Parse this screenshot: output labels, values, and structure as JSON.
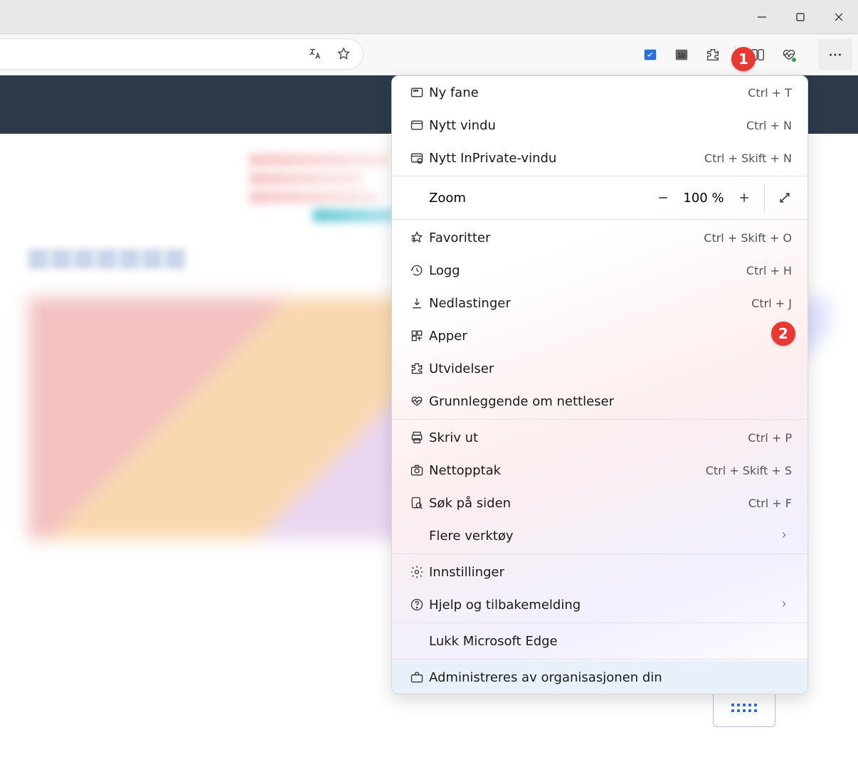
{
  "window": {
    "app": "Microsoft Edge"
  },
  "annotations": {
    "step1": "1",
    "step2": "2"
  },
  "toolbar": {
    "translate_icon": "translate-icon",
    "favorite_icon": "star-icon",
    "ext1_icon": "app-todo-icon",
    "ext2_icon": "app-1b-icon",
    "extensions_icon": "extensions-icon",
    "split_icon": "split-screen-icon",
    "health_icon": "browser-health-icon",
    "more_icon": "more-icon"
  },
  "menu": {
    "new_tab": {
      "label": "Ny fane",
      "shortcut": "Ctrl + T"
    },
    "new_window": {
      "label": "Nytt vindu",
      "shortcut": "Ctrl + N"
    },
    "new_inprivate": {
      "label": "Nytt InPrivate-vindu",
      "shortcut": "Ctrl + Skift + N"
    },
    "zoom": {
      "label": "Zoom",
      "value": "100 %"
    },
    "favorites": {
      "label": "Favoritter",
      "shortcut": "Ctrl + Skift + O"
    },
    "history": {
      "label": "Logg",
      "shortcut": "Ctrl + H"
    },
    "downloads": {
      "label": "Nedlastinger",
      "shortcut": "Ctrl + J"
    },
    "apps": {
      "label": "Apper"
    },
    "extensions": {
      "label": "Utvidelser"
    },
    "essentials": {
      "label": "Grunnleggende om nettleser"
    },
    "print": {
      "label": "Skriv ut",
      "shortcut": "Ctrl + P"
    },
    "capture": {
      "label": "Nettopptak",
      "shortcut": "Ctrl + Skift + S"
    },
    "find": {
      "label": "Søk på siden",
      "shortcut": "Ctrl + F"
    },
    "more_tools": {
      "label": "Flere verktøy"
    },
    "settings": {
      "label": "Innstillinger"
    },
    "help": {
      "label": "Hjelp og tilbakemelding"
    },
    "close": {
      "label": "Lukk Microsoft Edge"
    },
    "managed": {
      "label": "Administreres av organisasjonen din"
    }
  }
}
